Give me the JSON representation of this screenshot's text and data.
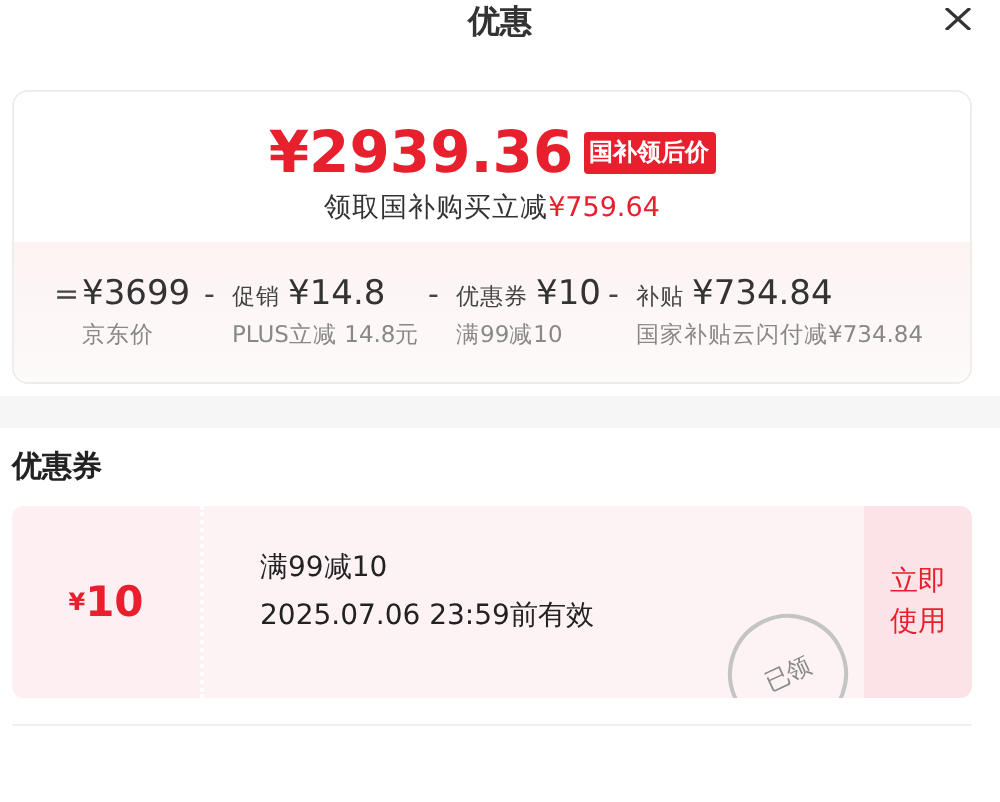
{
  "window": {
    "title": "优惠"
  },
  "summary": {
    "price": "¥2939.36",
    "price_tag": "国补领后价",
    "saving_label": "领取国补购买立减",
    "saving_amount": "¥759.64",
    "breakdown": [
      {
        "op": "=",
        "amount": "¥3699",
        "note": "京东价"
      },
      {
        "op": "-",
        "label": "促销",
        "amount": "¥14.8",
        "note": "PLUS立减 14.8元"
      },
      {
        "op": "-",
        "label": "优惠券",
        "amount": "¥10",
        "note": "满99减10"
      },
      {
        "op": "-",
        "label": "补贴",
        "amount": "¥734.84",
        "note": "国家补贴云闪付减¥734.84"
      }
    ]
  },
  "coupons_section": {
    "heading": "优惠券",
    "coupons": [
      {
        "amount_symbol": "¥",
        "amount": "10",
        "condition": "满99减10",
        "validity": "2025.07.06 23:59前有效",
        "stamp": "已领",
        "action": "立即使用"
      }
    ]
  }
}
